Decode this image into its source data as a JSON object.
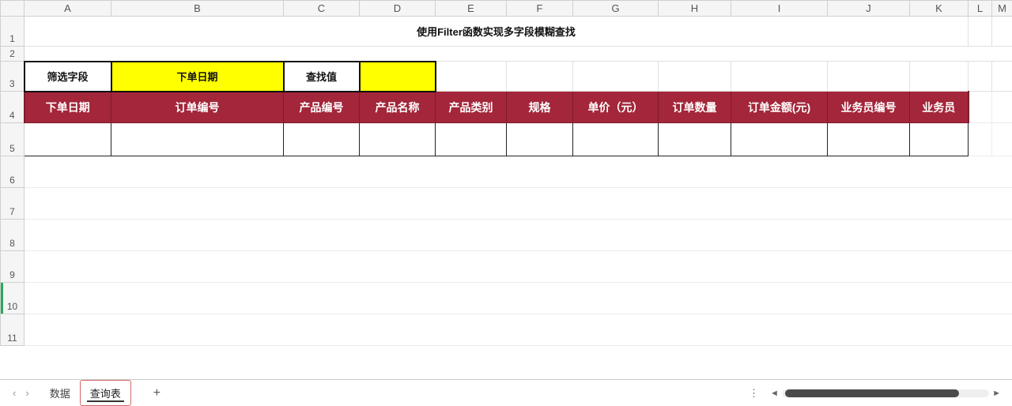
{
  "columns": [
    "A",
    "B",
    "C",
    "D",
    "E",
    "F",
    "G",
    "H",
    "I",
    "J",
    "K",
    "L",
    "M"
  ],
  "rows": [
    "1",
    "2",
    "3",
    "4",
    "5",
    "6",
    "7",
    "8",
    "9",
    "10",
    "11"
  ],
  "title": "使用Filter函数实现多字段模糊查找",
  "filter": {
    "field_label": "筛选字段",
    "field_value": "下单日期",
    "value_label": "查找值",
    "value_value": ""
  },
  "table_headers": [
    "下单日期",
    "订单编号",
    "产品编号",
    "产品名称",
    "产品类别",
    "规格",
    "单价（元）",
    "订单数量",
    "订单金额(元)",
    "业务员编号",
    "业务员"
  ],
  "sheet_tabs": {
    "inactive": "数据",
    "active": "查询表"
  },
  "misc": {
    "plus": "+",
    "dots": "⋮",
    "nav_prev": "‹",
    "nav_next": "›",
    "scroll_left": "◄",
    "scroll_right": "►"
  }
}
